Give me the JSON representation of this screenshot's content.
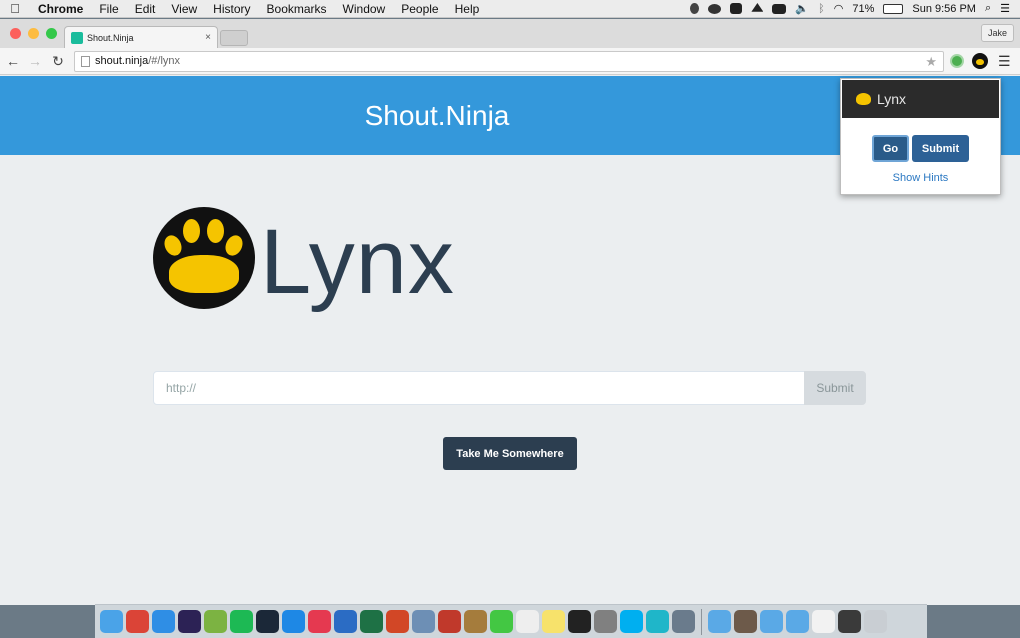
{
  "menubar": {
    "app_name": "Chrome",
    "items": [
      "File",
      "Edit",
      "View",
      "History",
      "Bookmarks",
      "Window",
      "People",
      "Help"
    ],
    "battery": "71%",
    "clock": "Sun 9:56 PM",
    "icons": [
      "apple-icon",
      "bell-icon",
      "eye-icon",
      "dropbox-icon",
      "drive-icon",
      "display-icon",
      "volume-icon",
      "bluetooth-icon",
      "wifi-icon",
      "battery-icon",
      "spotlight-icon",
      "list-icon"
    ]
  },
  "browser": {
    "tab_title": "Shout.Ninja",
    "tab_close": "×",
    "profile": "Jake",
    "url_host": "shout.ninja",
    "url_path": "/#/lynx",
    "star": "★",
    "menu": "☰",
    "back": "←",
    "forward": "→",
    "reload": "↻"
  },
  "site": {
    "brand": "Shout.Ninja",
    "wordmark": "Lynx",
    "input_placeholder": "http://",
    "input_value": "",
    "submit_label": "Submit",
    "take_me_label": "Take Me Somewhere"
  },
  "popup": {
    "title": "Lynx",
    "go_label": "Go",
    "submit_label": "Submit",
    "hints_label": "Show Hints"
  },
  "colors": {
    "header": "#3498db",
    "primary_dark": "#2c3e50",
    "lynx_yellow": "#f5c400",
    "popup_header": "#2b2b2b"
  },
  "dock": {
    "icons": [
      {
        "name": "finder-icon",
        "color": "#4aa3e8"
      },
      {
        "name": "chrome-icon",
        "color": "#db4437"
      },
      {
        "name": "safari-icon",
        "color": "#2f8ee5"
      },
      {
        "name": "eclipse-icon",
        "color": "#2c2255"
      },
      {
        "name": "android-studio-icon",
        "color": "#7cb342"
      },
      {
        "name": "spotify-icon",
        "color": "#1db954"
      },
      {
        "name": "steam-icon",
        "color": "#1b2838"
      },
      {
        "name": "app-store-icon",
        "color": "#1e88e5"
      },
      {
        "name": "itunes-icon",
        "color": "#e53950"
      },
      {
        "name": "word-icon",
        "color": "#2b6cc4"
      },
      {
        "name": "excel-icon",
        "color": "#1e7145"
      },
      {
        "name": "powerpoint-icon",
        "color": "#d24726"
      },
      {
        "name": "preview-icon",
        "color": "#6d8fb5"
      },
      {
        "name": "photo-booth-icon",
        "color": "#c0392b"
      },
      {
        "name": "notebook-icon",
        "color": "#a57c3c"
      },
      {
        "name": "messages-icon",
        "color": "#43c743"
      },
      {
        "name": "textedit-icon",
        "color": "#eeeeee"
      },
      {
        "name": "notes-icon",
        "color": "#f7e26b"
      },
      {
        "name": "terminal-icon",
        "color": "#222222"
      },
      {
        "name": "system-preferences-icon",
        "color": "#808080"
      },
      {
        "name": "skype-icon",
        "color": "#00aff0"
      },
      {
        "name": "webstorm-icon",
        "color": "#1fb6c9"
      },
      {
        "name": "screenshot-icon",
        "color": "#6a7b8c"
      },
      {
        "name": "sep"
      },
      {
        "name": "folder-icon",
        "color": "#5aa9e6"
      },
      {
        "name": "downloads-folder-icon",
        "color": "#6d5a4a"
      },
      {
        "name": "documents-folder-icon",
        "color": "#5aa9e6"
      },
      {
        "name": "applications-folder-icon",
        "color": "#5aa9e6"
      },
      {
        "name": "file-icon",
        "color": "#f2f2f2"
      },
      {
        "name": "display-stack-icon",
        "color": "#3a3a3a"
      },
      {
        "name": "trash-icon",
        "color": "#c9ced3"
      }
    ]
  }
}
